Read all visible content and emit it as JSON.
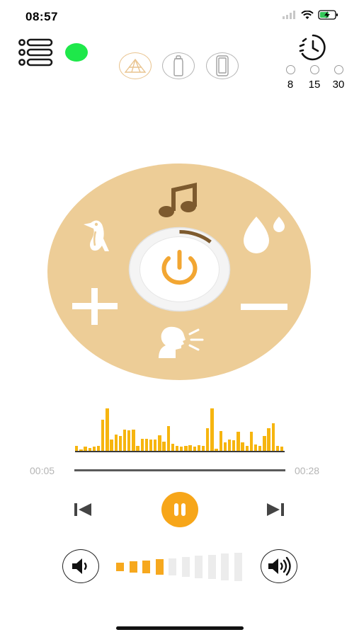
{
  "status_bar": {
    "time": "08:57"
  },
  "header": {
    "menu_icon": "list-menu-icon",
    "connection_color": "#1ee84a",
    "mode_buttons": [
      {
        "name": "tent-mode",
        "icon": "tent-icon",
        "active": true
      },
      {
        "name": "bottle-mode",
        "icon": "bottle-icon",
        "active": false
      },
      {
        "name": "phone-mode",
        "icon": "phone-icon",
        "active": false
      }
    ],
    "timer": {
      "icon": "timer-icon",
      "options": [
        "8",
        "15",
        "30"
      ]
    }
  },
  "sound_dial": {
    "background_color": "#edcd97",
    "accent_color": "#7d5a2e",
    "power_color": "#f2a632",
    "items": [
      "music-note-icon",
      "bird-icon",
      "water-drop-icon",
      "plus-icon",
      "minus-icon",
      "voice-icon"
    ],
    "power_icon": "power-icon",
    "progress": 0.12
  },
  "player": {
    "waveform_color": "#f6b50f",
    "waveform_levels": [
      0.12,
      0.05,
      0.1,
      0.08,
      0.1,
      0.12,
      0.68,
      0.93,
      0.26,
      0.36,
      0.33,
      0.47,
      0.46,
      0.47,
      0.12,
      0.28,
      0.28,
      0.26,
      0.26,
      0.35,
      0.22,
      0.55,
      0.16,
      0.12,
      0.1,
      0.12,
      0.14,
      0.1,
      0.14,
      0.12,
      0.5,
      0.93,
      0.06,
      0.44,
      0.2,
      0.26,
      0.24,
      0.43,
      0.2,
      0.12,
      0.43,
      0.15,
      0.12,
      0.33,
      0.5,
      0.6,
      0.12,
      0.1
    ],
    "elapsed": "00:05",
    "total": "00:28",
    "prev_icon": "skip-previous-icon",
    "pause_icon": "pause-icon",
    "next_icon": "skip-next-icon",
    "pause_color": "#f7a619"
  },
  "volume": {
    "down_icon": "volume-down-icon",
    "up_icon": "volume-up-icon",
    "level": 4,
    "segments": 10,
    "active_color": "#f6a81e",
    "inactive_color": "#ececec"
  }
}
